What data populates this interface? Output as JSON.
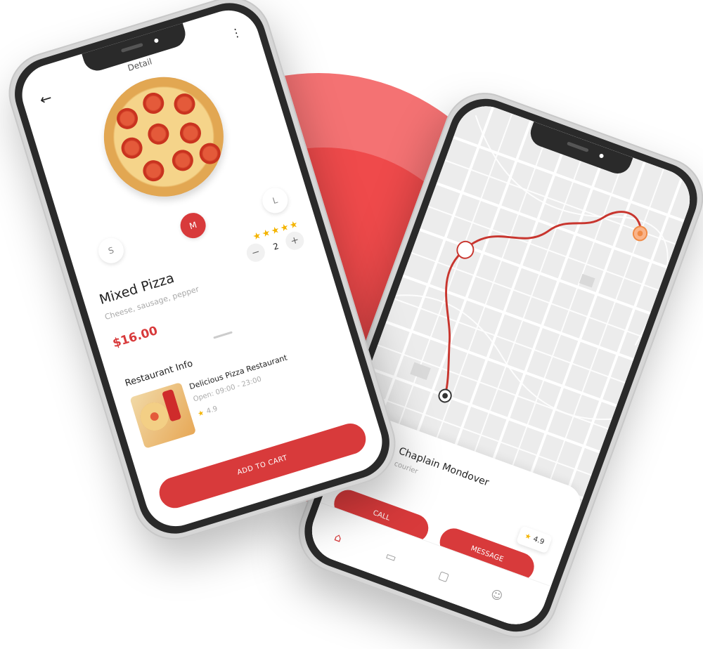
{
  "detail": {
    "title": "Detail",
    "back_icon": "arrow-left-icon",
    "menu_icon": "more-vertical-icon",
    "sizes": [
      "S",
      "M",
      "L"
    ],
    "selected_size": "M",
    "rating_stars": "★★★★★",
    "item_name": "Mixed Pizza",
    "item_desc": "Cheese, sausage, pepper",
    "quantity": "2",
    "minus": "−",
    "plus": "+",
    "price": "$16.00",
    "section_title": "Restaurant Info",
    "restaurant": {
      "name": "Delicious Pizza Restaurant",
      "hours": "Open: 09:00 - 23:00",
      "rating": "4.9"
    },
    "add_to_cart": "ADD TO CART"
  },
  "tracking": {
    "courier_name": "Chaplain Mondover",
    "courier_role": "courier",
    "rating": "4.9",
    "call_label": "CALL",
    "message_label": "MESSAGE",
    "tabs": [
      "home-icon",
      "book-icon",
      "bag-icon",
      "user-icon"
    ]
  },
  "colors": {
    "accent": "#d83a3b",
    "bg_circle": "#f47273",
    "bg_inner": "#ef4a4b",
    "star": "#f4b400"
  }
}
